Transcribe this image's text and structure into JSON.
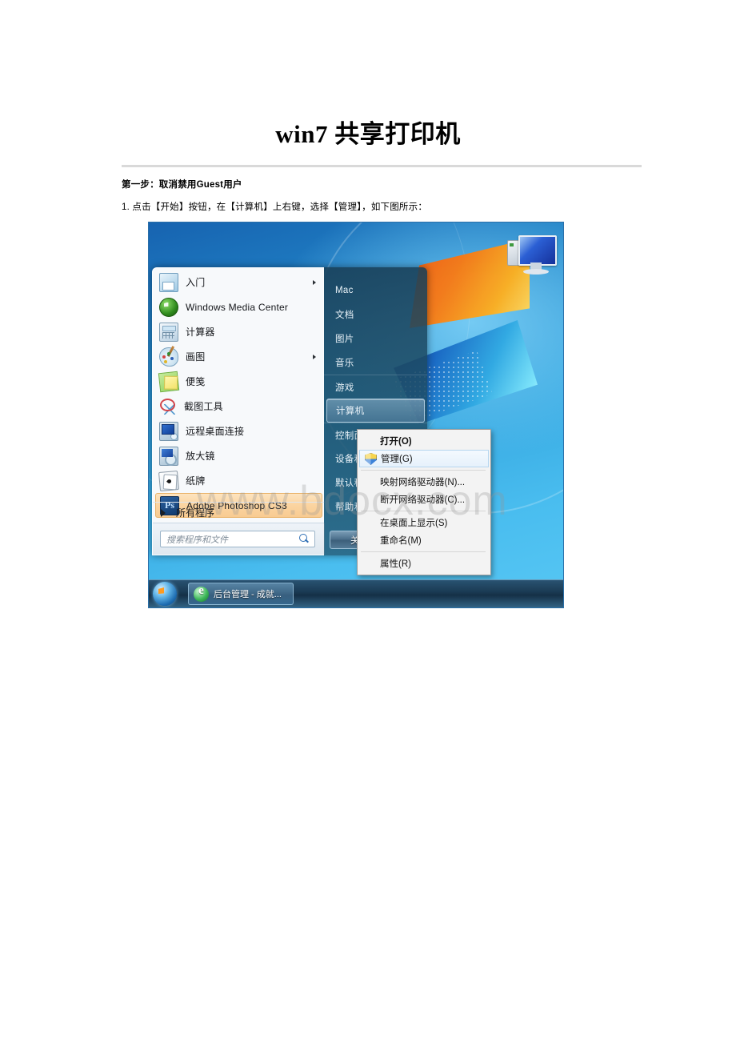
{
  "document": {
    "title": "win7 共享打印机",
    "step_heading": "第一步：取消禁用Guest用户",
    "step_text": "1. 点击【开始】按钮，在【计算机】上右键，选择【管理】，如下图所示："
  },
  "screenshot": {
    "watermark": "www.bdocx.com",
    "start_menu": {
      "apps": [
        {
          "label": "入门",
          "icon": "get-started-icon",
          "has_submenu": true,
          "selected": false
        },
        {
          "label": "Windows Media Center",
          "icon": "windows-media-center-icon",
          "has_submenu": false,
          "selected": false
        },
        {
          "label": "计算器",
          "icon": "calculator-icon",
          "has_submenu": false,
          "selected": false
        },
        {
          "label": "画图",
          "icon": "paint-icon",
          "has_submenu": true,
          "selected": false
        },
        {
          "label": "便笺",
          "icon": "sticky-notes-icon",
          "has_submenu": false,
          "selected": false
        },
        {
          "label": "截图工具",
          "icon": "snipping-tool-icon",
          "has_submenu": false,
          "selected": false
        },
        {
          "label": "远程桌面连接",
          "icon": "remote-desktop-icon",
          "has_submenu": false,
          "selected": false
        },
        {
          "label": "放大镜",
          "icon": "magnifier-icon",
          "has_submenu": false,
          "selected": false
        },
        {
          "label": "纸牌",
          "icon": "solitaire-icon",
          "has_submenu": false,
          "selected": false
        },
        {
          "label": "Adobe Photoshop CS3",
          "icon": "photoshop-icon",
          "has_submenu": false,
          "selected": true
        }
      ],
      "all_programs_label": "所有程序",
      "search_placeholder": "搜索程序和文件",
      "user_name": "Mac",
      "right_items": [
        {
          "label": "Mac",
          "highlighted": false,
          "separator": false
        },
        {
          "label": "文档",
          "highlighted": false,
          "separator": false
        },
        {
          "label": "图片",
          "highlighted": false,
          "separator": false
        },
        {
          "label": "音乐",
          "highlighted": false,
          "separator": false
        },
        {
          "label": "游戏",
          "highlighted": false,
          "separator": true
        },
        {
          "label": "计算机",
          "highlighted": true,
          "separator": false
        },
        {
          "label": "控制面板",
          "highlighted": false,
          "separator": true
        },
        {
          "label": "设备和打印机",
          "highlighted": false,
          "separator": false
        },
        {
          "label": "默认程序",
          "highlighted": false,
          "separator": false
        },
        {
          "label": "帮助和支持",
          "highlighted": false,
          "separator": false
        }
      ],
      "shutdown_label": "关机"
    },
    "context_menu": {
      "items": [
        {
          "label": "打开(O)",
          "bold": true,
          "highlighted": false,
          "icon": null,
          "separator_after": false
        },
        {
          "label": "管理(G)",
          "bold": false,
          "highlighted": true,
          "icon": "uac-shield-icon",
          "separator_after": true
        },
        {
          "label": "映射网络驱动器(N)...",
          "bold": false,
          "highlighted": false,
          "icon": null,
          "separator_after": false
        },
        {
          "label": "断开网络驱动器(C)...",
          "bold": false,
          "highlighted": false,
          "icon": null,
          "separator_after": true
        },
        {
          "label": "在桌面上显示(S)",
          "bold": false,
          "highlighted": false,
          "icon": null,
          "separator_after": false
        },
        {
          "label": "重命名(M)",
          "bold": false,
          "highlighted": false,
          "icon": null,
          "separator_after": true
        },
        {
          "label": "属性(R)",
          "bold": false,
          "highlighted": false,
          "icon": null,
          "separator_after": false
        }
      ]
    },
    "taskbar": {
      "start_orb": "windows-start-orb-icon",
      "tasks": [
        {
          "label": "后台管理 - 成就...",
          "icon": "internet-explorer-icon"
        }
      ]
    },
    "colors": {
      "selection_orange": "#f8cb92",
      "desktop_blue": "#34a5df",
      "menu_panel": "#f7f9fb",
      "right_panel": "#1e4e68"
    }
  }
}
